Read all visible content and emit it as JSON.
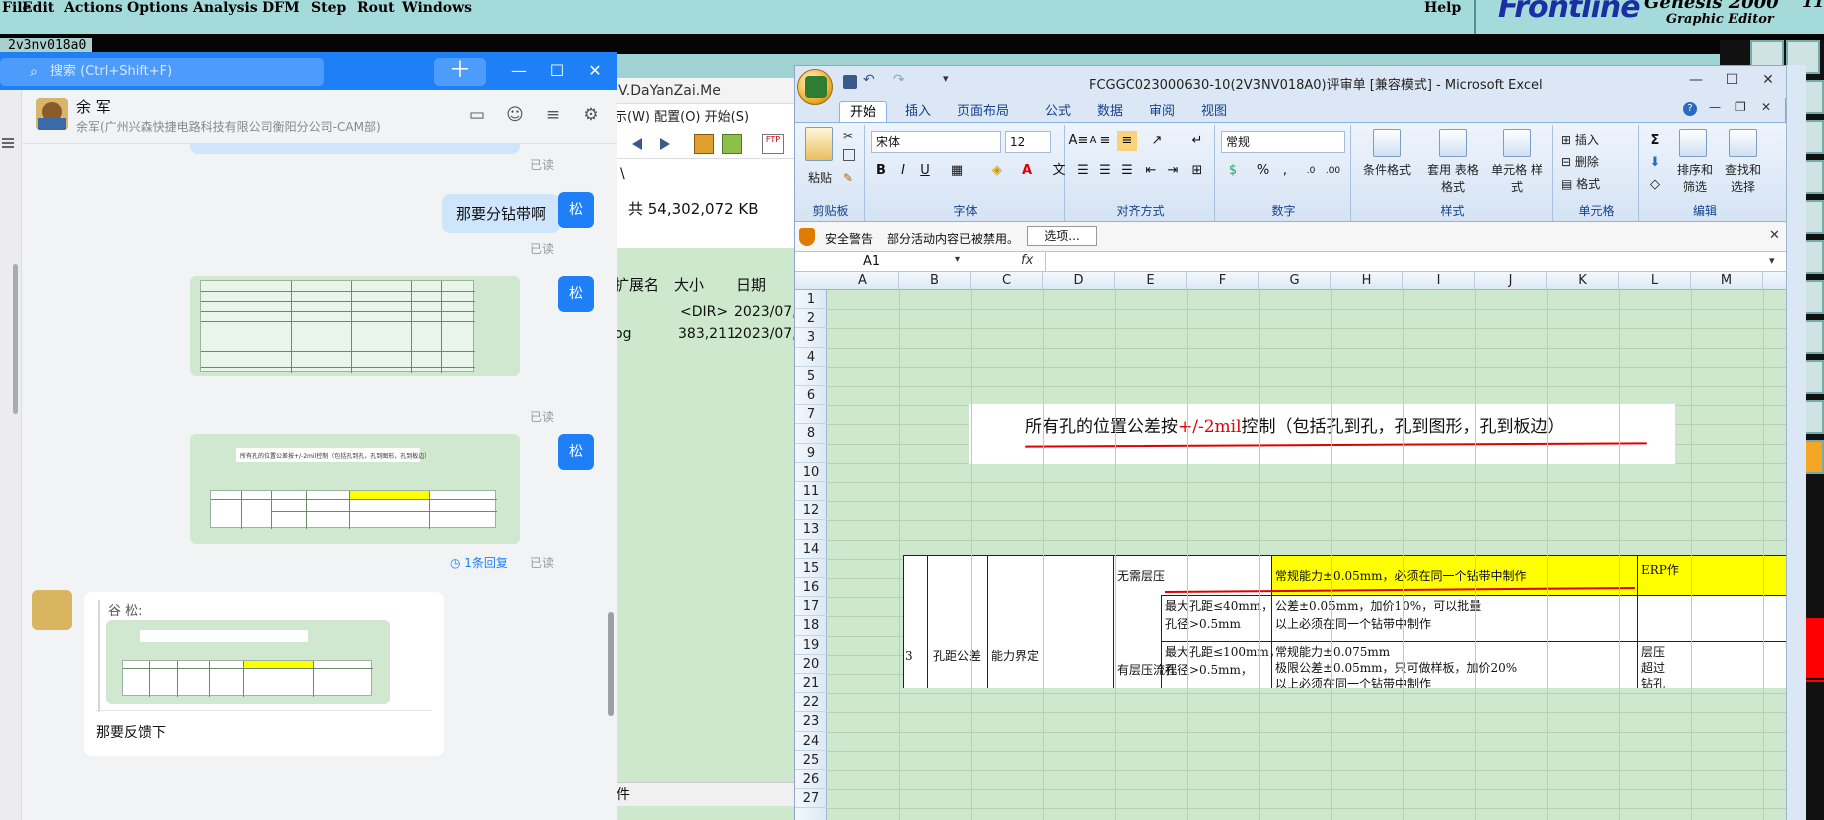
{
  "genesis": {
    "menu": [
      "File",
      "Edit",
      "Actions",
      "Options",
      "Analysis",
      "DFM",
      "Step",
      "Rout",
      "Windows"
    ],
    "help": "Help",
    "logo": "Frontline",
    "title": "Genesis 2000",
    "subtitle": "Graphic Editor",
    "time": "11:",
    "job_tab": "2v3nv018a0"
  },
  "explorer": {
    "address": "V.DaYanZai.Me",
    "menus": "示(W)  配置(O)  开始(S)",
    "path": "\\",
    "total": "共 54,302,072 KB",
    "headers": [
      "扩展名",
      "大小",
      "日期"
    ],
    "rows": [
      {
        "ext": "",
        "size": "<DIR>",
        "date": "2023/07,"
      },
      {
        "ext": "og",
        "size": "383,211",
        "date": "2023/07,"
      }
    ],
    "bottom": "件"
  },
  "chat": {
    "search_placeholder": "搜索 (Ctrl+Shift+F)",
    "contact_name": "余 军",
    "contact_org": "余军(广州兴森快捷电路科技有限公司衡阳分公司-CAM部)",
    "read_label": "已读",
    "self_avatar_text": "松",
    "messages": {
      "text1": "那要分钻带啊",
      "reply_count": "1条回复",
      "quote_name": "谷 松:",
      "text2": "那要反馈下"
    },
    "mini_sheet_line": "所有孔的位置公差按+/-2mil控制（包括孔到孔，孔到图形，孔到板边）"
  },
  "excel": {
    "title": "FCGGC023000630-10(2V3NV018A0)评审单  [兼容模式] - Microsoft Excel",
    "tabs": [
      "开始",
      "插入",
      "页面布局",
      "公式",
      "数据",
      "审阅",
      "视图"
    ],
    "ribbon": {
      "paste": "粘贴",
      "clipboard": "剪贴板",
      "font_name": "宋体",
      "font_size": "12",
      "font_group": "字体",
      "align_group": "对齐方式",
      "number_format": "常规",
      "number_group": "数字",
      "cond_format": "条件格式",
      "table_format": "套用 表格格式",
      "cell_style": "单元格 样式",
      "style_group": "样式",
      "insert": "插入",
      "delete": "删除",
      "format": "格式",
      "cells_group": "单元格",
      "sort_filter": "排序和 筛选",
      "find_select": "查找和 选择",
      "edit_group": "编辑"
    },
    "security_warning": "安全警告",
    "security_message": "部分活动内容已被禁用。",
    "security_options": "选项...",
    "name_box": "A1",
    "fx": "fx",
    "columns": [
      "A",
      "B",
      "C",
      "D",
      "E",
      "F",
      "G",
      "H",
      "I",
      "J",
      "K",
      "L",
      "M"
    ],
    "rows": [
      "1",
      "2",
      "3",
      "4",
      "5",
      "6",
      "7",
      "8",
      "9",
      "10",
      "11",
      "12",
      "13",
      "14",
      "15",
      "16",
      "17",
      "18",
      "19",
      "20",
      "21",
      "22",
      "23",
      "24",
      "25",
      "26",
      "27"
    ],
    "pasted_text": {
      "prefix": "所有孔的位置公差按",
      "red": "+/-2mil",
      "suffix": "控制（包括孔到孔，孔到图形，孔到板边）"
    },
    "table": {
      "row_no": "3",
      "item": "孔距公差",
      "category": "能力界定",
      "no_press": "无需层压",
      "normal": "常规能力±0.05mm，必须在同一个钻带中制作",
      "erp": "ERP作",
      "max40": "最大孔距≤40mm，",
      "dia1": "孔径>0.5mm",
      "tol1": "公差±0.05mm，加价10%，可以批量",
      "same1": "以上必须在同一个钻带中制作",
      "layer_flow": "有层压流程",
      "max100": "最大孔距≤100mm，",
      "dia2": "孔径>0.5mm，",
      "normal2": "常规能力±0.075mm",
      "limit2": "极限公差±0.05mm，只可做样板，加价20%",
      "same2": "以上必须在同一个钻带中制作",
      "right1": "层压",
      "right2": "超过",
      "right3": "钻孔"
    }
  }
}
